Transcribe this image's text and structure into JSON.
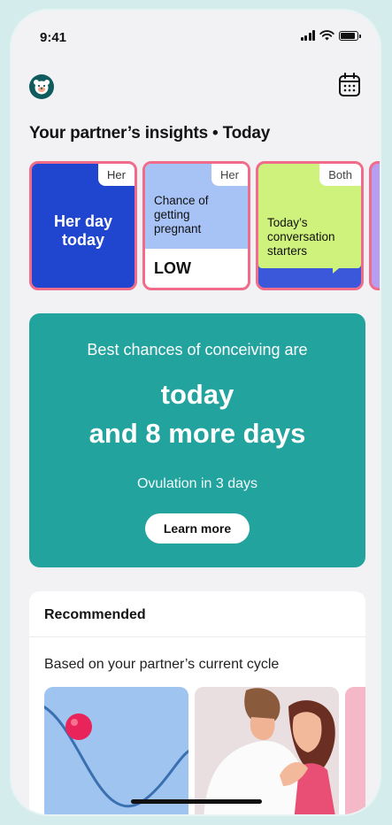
{
  "status_bar": {
    "time": "9:41",
    "battery_level": 0.9
  },
  "header": {
    "avatar_icon": "bear-face-icon",
    "calendar_icon": "calendar-icon"
  },
  "section_title": "Your partner’s insights • Today",
  "insight_cards": [
    {
      "tag": "Her",
      "title": "Her day today",
      "color": "#2046d0"
    },
    {
      "tag": "Her",
      "title": "Chance of getting pregnant",
      "value": "LOW",
      "color": "#a7c3f6"
    },
    {
      "tag": "Both",
      "title": "Today’s conversation starters",
      "color": "#cff27c"
    }
  ],
  "hero": {
    "line1": "Best chances of conceiving are",
    "line2": "today",
    "line3": "and 8 more days",
    "line4": "Ovulation in 3 days",
    "button": "Learn more",
    "color": "#22a39e"
  },
  "recommended": {
    "title": "Recommended",
    "subtitle": "Based on your partner’s current cycle"
  },
  "accent_color": "#f06c8a"
}
